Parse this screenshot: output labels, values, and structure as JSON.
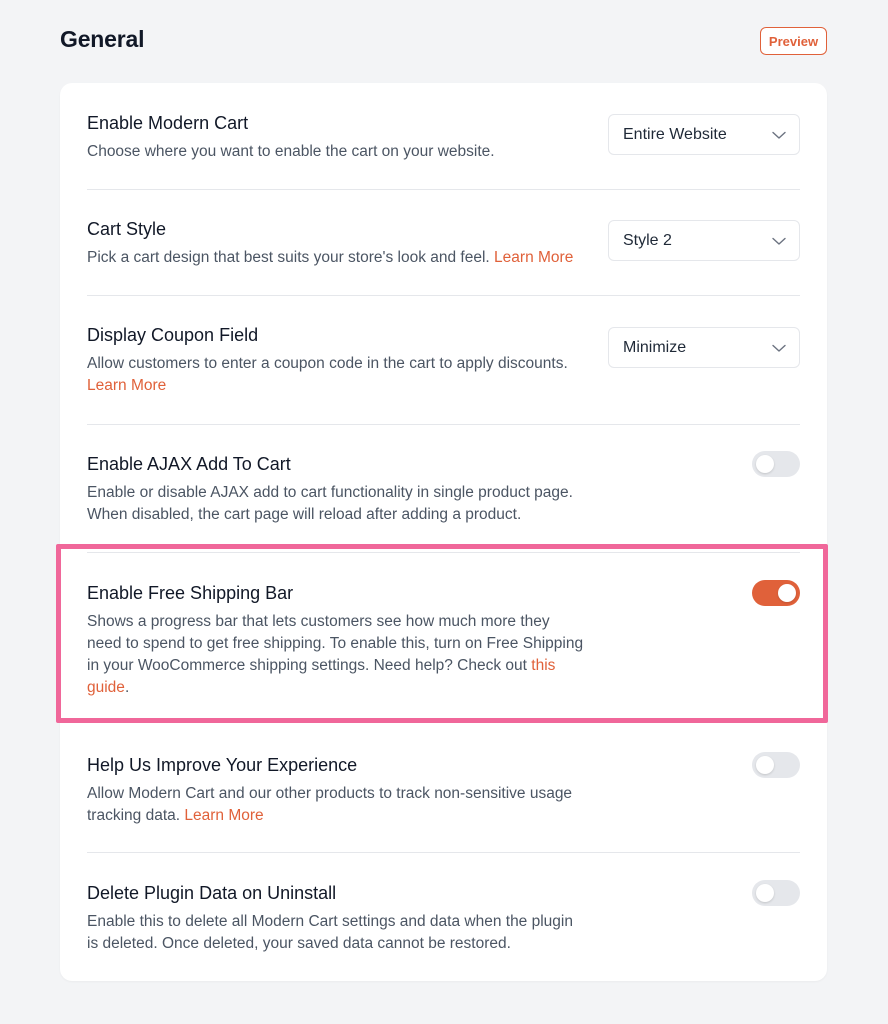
{
  "header": {
    "title": "General",
    "preview_label": "Preview"
  },
  "colors": {
    "accent": "#e0613a",
    "highlight": "#f0679a",
    "toggle_off": "#e5e7eb"
  },
  "settings": [
    {
      "title": "Enable Modern Cart",
      "desc": "Choose where you want to enable the cart on your website.",
      "control": "select",
      "value": "Entire Website"
    },
    {
      "title": "Cart Style",
      "desc": "Pick a cart design that best suits your store's look and feel.",
      "link": "Learn More",
      "control": "select",
      "value": "Style 2"
    },
    {
      "title": "Display Coupon Field",
      "desc": "Allow customers to enter a coupon code in the cart to apply discounts.",
      "link": "Learn More",
      "control": "select",
      "value": "Minimize"
    },
    {
      "title": "Enable AJAX Add To Cart",
      "desc": "Enable or disable AJAX add to cart functionality in single product page. When disabled, the cart page will reload after adding a product.",
      "control": "toggle",
      "enabled": false
    },
    {
      "title": "Enable Free Shipping Bar",
      "desc": "Shows a progress bar that lets customers see how much more they need to spend to get free shipping. To enable this, turn on Free Shipping in your WooCommerce shipping settings. Need help? Check out",
      "link": "this guide",
      "desc_suffix": ".",
      "control": "toggle",
      "enabled": true
    },
    {
      "title": "Help Us Improve Your Experience",
      "desc": "Allow Modern Cart and our other products to track non-sensitive usage tracking data.",
      "link": "Learn More",
      "control": "toggle",
      "enabled": false
    },
    {
      "title": "Delete Plugin Data on Uninstall",
      "desc": "Enable this to delete all Modern Cart settings and data when the plugin is deleted. Once deleted, your saved data cannot be restored.",
      "control": "toggle",
      "enabled": false
    }
  ]
}
